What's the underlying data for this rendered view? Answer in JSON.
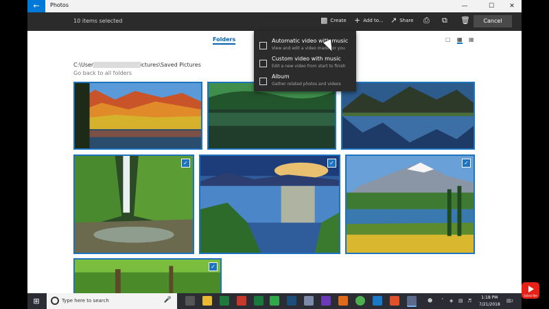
{
  "app": {
    "title": "Photos"
  },
  "window_controls": {
    "minimize": "—",
    "maximize": "☐",
    "close": "✕"
  },
  "commandbar": {
    "selection": "10 items selected",
    "create": "Create",
    "add_to": "Add to...",
    "share": "Share",
    "cancel": "Cancel"
  },
  "view": {
    "tab": "Folders"
  },
  "location": {
    "path_prefix": "C:\\User",
    "path_suffix": "ictures\\Saved Pictures",
    "back_link": "Go back to all folders"
  },
  "create_menu": [
    {
      "title": "Automatic video with music",
      "subtitle": "View and edit a video made for you"
    },
    {
      "title": "Custom video with music",
      "subtitle": "Edit a new video from start to finish"
    },
    {
      "title": "Album",
      "subtitle": "Gather related photos and videos"
    }
  ],
  "photos": [
    {
      "name": "autumn-lake",
      "selected": true
    },
    {
      "name": "green-lake",
      "selected": true
    },
    {
      "name": "mountain-lake",
      "selected": true
    },
    {
      "name": "waterfall",
      "selected": true
    },
    {
      "name": "sunset-lake",
      "selected": true
    },
    {
      "name": "snowy-mountain",
      "selected": true
    },
    {
      "name": "forest",
      "selected": true
    }
  ],
  "taskbar": {
    "search_placeholder": "Type here to search",
    "time": "1:18 PM",
    "date": "7/21/2018",
    "notification_count": "2"
  },
  "overlay": {
    "subscribe": "Subscribe"
  },
  "colors": {
    "accent": "#0078d7",
    "commandbar": "#2b2b2b",
    "selection_border": "#1e73be"
  }
}
